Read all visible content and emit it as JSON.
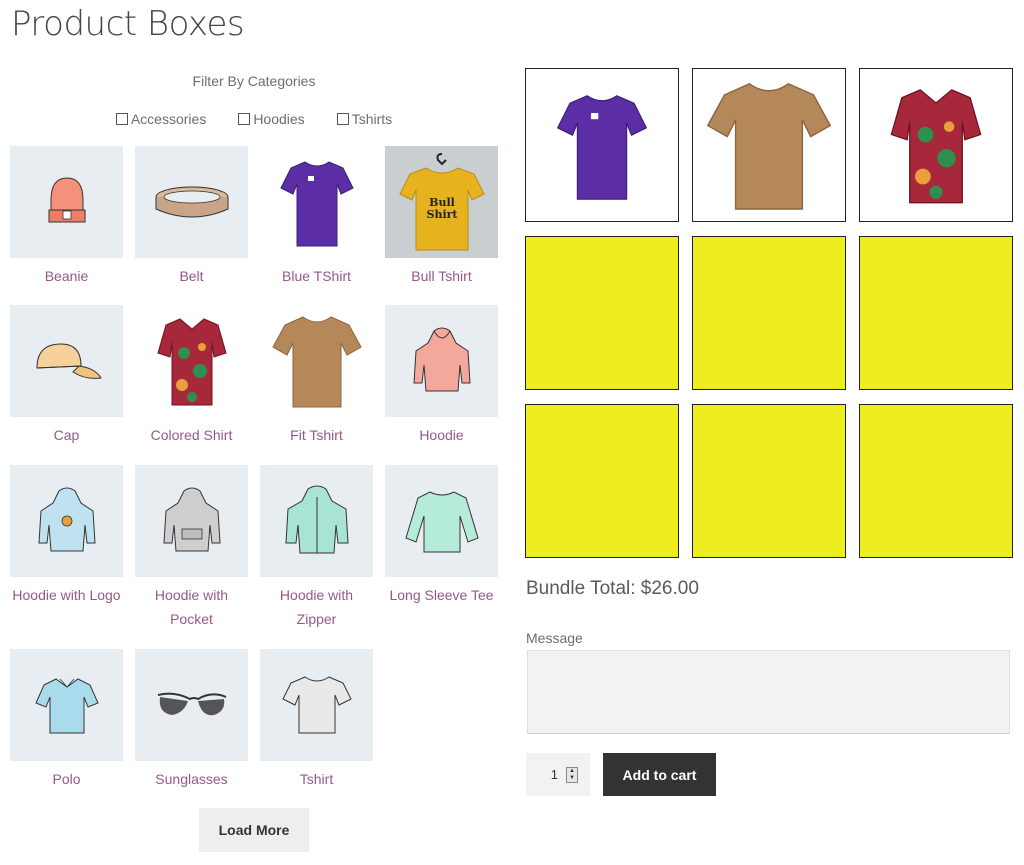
{
  "page_title": "Product Boxes",
  "filter": {
    "title": "Filter By Categories",
    "options": [
      "Accessories",
      "Hoodies",
      "Tshirts"
    ]
  },
  "products": [
    {
      "name": "Beanie",
      "icon": "beanie-icon"
    },
    {
      "name": "Belt",
      "icon": "belt-icon"
    },
    {
      "name": "Blue TShirt",
      "icon": "blue-tshirt-image"
    },
    {
      "name": "Bull Tshirt",
      "icon": "bull-tshirt-image"
    },
    {
      "name": "Cap",
      "icon": "cap-icon"
    },
    {
      "name": "Colored Shirt",
      "icon": "colored-shirt-image"
    },
    {
      "name": "Fit Tshirt",
      "icon": "fit-tshirt-image"
    },
    {
      "name": "Hoodie",
      "icon": "hoodie-icon"
    },
    {
      "name": "Hoodie with Logo",
      "icon": "hoodie-logo-icon"
    },
    {
      "name": "Hoodie with Pocket",
      "icon": "hoodie-pocket-icon"
    },
    {
      "name": "Hoodie with Zipper",
      "icon": "hoodie-zipper-icon"
    },
    {
      "name": "Long Sleeve Tee",
      "icon": "long-sleeve-icon"
    },
    {
      "name": "Polo",
      "icon": "polo-icon"
    },
    {
      "name": "Sunglasses",
      "icon": "sunglasses-icon"
    },
    {
      "name": "Tshirt",
      "icon": "tshirt-icon"
    }
  ],
  "load_more_label": "Load More",
  "box_slots": [
    {
      "filled": true,
      "item": "Blue TShirt"
    },
    {
      "filled": true,
      "item": "Fit Tshirt"
    },
    {
      "filled": true,
      "item": "Colored Shirt"
    },
    {
      "filled": false
    },
    {
      "filled": false
    },
    {
      "filled": false
    },
    {
      "filled": false
    },
    {
      "filled": false
    },
    {
      "filled": false
    }
  ],
  "bundle_total": "Bundle Total: $26.00",
  "message_label": "Message",
  "message_value": "",
  "quantity": "1",
  "add_to_cart_label": "Add to cart",
  "colors": {
    "link": "#96588a",
    "empty_slot": "#eded20",
    "button_dark": "#333333",
    "thumb_bg": "#e8edf2"
  },
  "bull_tshirt_print": "Bull Shirt"
}
